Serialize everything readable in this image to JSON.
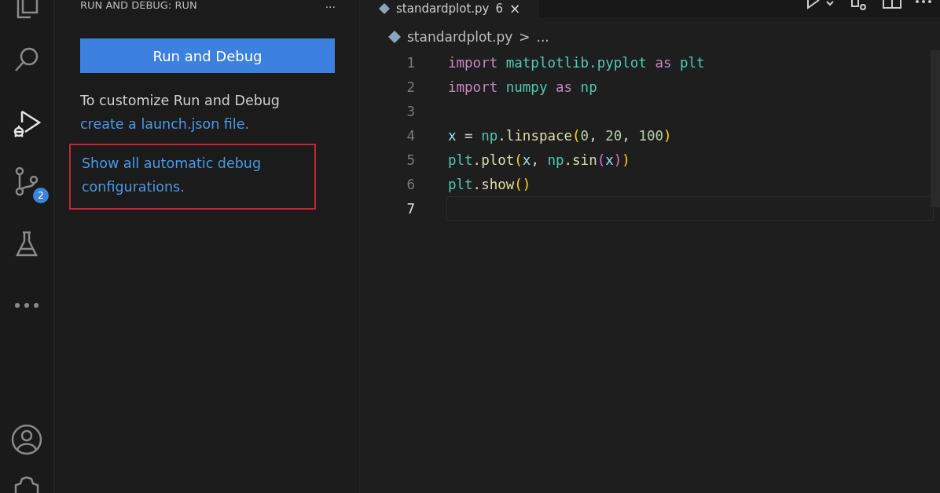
{
  "activity_bar": {
    "items": [
      {
        "kind": "explorer",
        "selected": false
      },
      {
        "kind": "search",
        "selected": false
      },
      {
        "kind": "run-debug",
        "selected": true
      },
      {
        "kind": "source-control",
        "selected": false,
        "badge": "2"
      },
      {
        "kind": "testing",
        "selected": false
      },
      {
        "kind": "more",
        "selected": false
      }
    ],
    "bottom_items": [
      {
        "kind": "account"
      },
      {
        "kind": "settings"
      }
    ]
  },
  "sidebar": {
    "title": "RUN AND DEBUG: RUN",
    "more": "···",
    "button": "Run and Debug",
    "hint": "To customize Run and Debug",
    "link": "create a launch.json file.",
    "highlighted_link": "Show all automatic debug configurations."
  },
  "editor": {
    "tab": {
      "label": "standardplot.py",
      "problems": "6",
      "close": "×"
    },
    "breadcrumb": {
      "file": "standardplot.py",
      "separator": ">",
      "more": "..."
    },
    "lines": [
      {
        "number": "1",
        "selected": false,
        "tokens": [
          {
            "text": "import",
            "kind": "keyword"
          },
          {
            "text": " matplotlib.pyplot ",
            "kind": "module"
          },
          {
            "text": "as",
            "kind": "keyword"
          },
          {
            "text": " plt",
            "kind": "module"
          }
        ]
      },
      {
        "number": "2",
        "selected": false,
        "tokens": [
          {
            "text": "import",
            "kind": "keyword"
          },
          {
            "text": " numpy ",
            "kind": "module"
          },
          {
            "text": "as",
            "kind": "keyword"
          },
          {
            "text": " np",
            "kind": "module"
          }
        ]
      },
      {
        "number": "3",
        "selected": false
      },
      {
        "number": "4",
        "selected": false,
        "tokens": [
          {
            "text": "x",
            "kind": "variable"
          },
          {
            "text": " = ",
            "kind": "operator"
          },
          {
            "text": "np",
            "kind": "module"
          },
          {
            "text": ".linspace",
            "kind": "function"
          },
          {
            "text": "(",
            "kind": "bracket"
          },
          {
            "text": "0",
            "kind": "number"
          },
          {
            "text": ", ",
            "kind": "operator"
          },
          {
            "text": "20",
            "kind": "number"
          },
          {
            "text": ", ",
            "kind": "operator"
          },
          {
            "text": "100",
            "kind": "number"
          },
          {
            "text": ")",
            "kind": "bracket"
          }
        ]
      },
      {
        "number": "5",
        "selected": false,
        "tokens": [
          {
            "text": "plt",
            "kind": "module"
          },
          {
            "text": ".plot",
            "kind": "function"
          },
          {
            "text": "(",
            "kind": "bracket"
          },
          {
            "text": "x",
            "kind": "variable"
          },
          {
            "text": ", ",
            "kind": "operator"
          },
          {
            "text": "np",
            "kind": "module"
          },
          {
            "text": ".sin",
            "kind": "function"
          },
          {
            "text": "(",
            "kind": "bracket2"
          },
          {
            "text": "x",
            "kind": "variable"
          },
          {
            "text": ")",
            "kind": "bracket2"
          },
          {
            "text": ")",
            "kind": "bracket"
          }
        ]
      },
      {
        "number": "6",
        "selected": false,
        "tokens": [
          {
            "text": "plt",
            "kind": "module"
          },
          {
            "text": ".show",
            "kind": "function"
          },
          {
            "text": "()",
            "kind": "bracket"
          }
        ]
      },
      {
        "number": "7",
        "selected": true
      }
    ]
  }
}
